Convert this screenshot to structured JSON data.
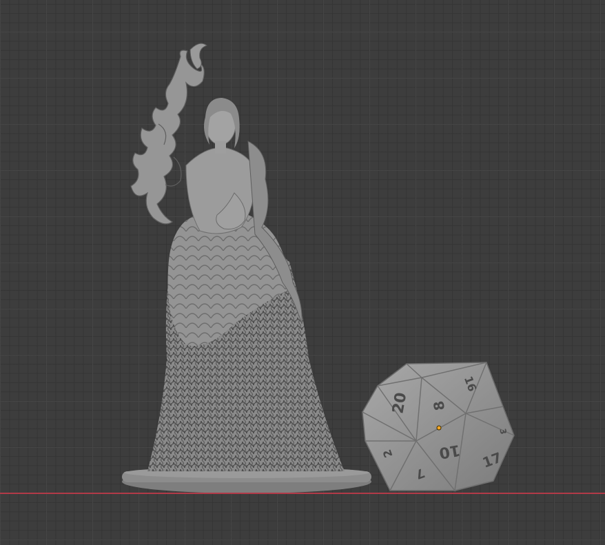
{
  "viewport": {
    "background_color": "#3d3d3d",
    "grid_color": "#464646",
    "x_axis_color": "#b23a48",
    "model_color": "#8f8f8f",
    "origin_marker_color": "#f5a623"
  },
  "objects": [
    {
      "name": "sorceress-miniature"
    },
    {
      "name": "d20-die"
    }
  ],
  "d20_faces": {
    "face_20": "20",
    "face_8": "8",
    "face_10": "10",
    "face_17": "17",
    "face_16": "16",
    "face_7": "7",
    "face_3": "3",
    "face_2": "2"
  }
}
